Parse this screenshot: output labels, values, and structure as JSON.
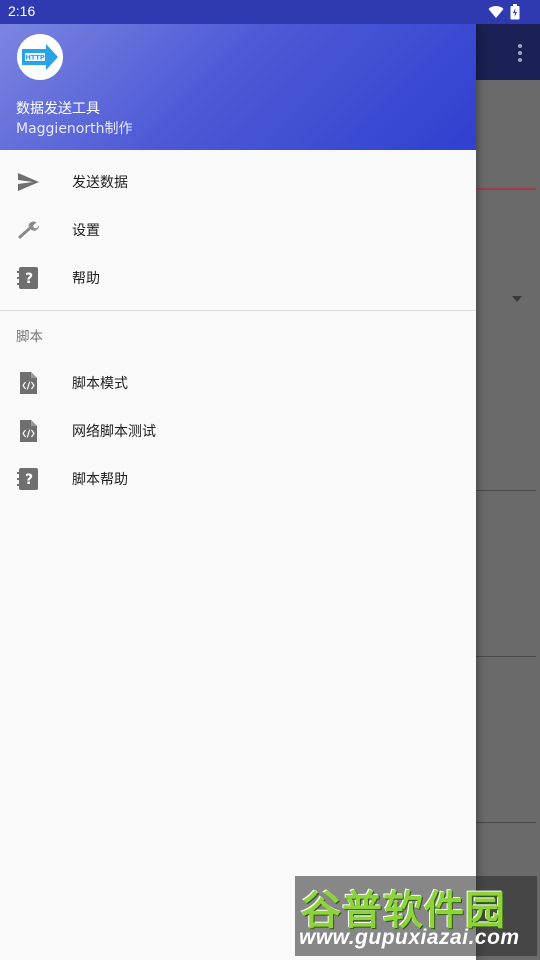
{
  "status_bar": {
    "time": "2:16",
    "icons": [
      "wifi-icon",
      "battery-icon"
    ]
  },
  "drawer": {
    "header": {
      "logo_icon": "http-arrow-logo",
      "title": "数据发送工具",
      "subtitle": "Maggienorth制作"
    },
    "items": [
      {
        "label": "发送数据",
        "icon": "send-icon"
      },
      {
        "label": "设置",
        "icon": "wrench-icon"
      },
      {
        "label": "帮助",
        "icon": "help-book-icon"
      }
    ],
    "section": {
      "title": "脚本",
      "items": [
        {
          "label": "脚本模式",
          "icon": "code-file-icon"
        },
        {
          "label": "网络脚本测试",
          "icon": "code-file-icon"
        },
        {
          "label": "脚本帮助",
          "icon": "help-book-icon"
        }
      ]
    }
  },
  "watermark": {
    "brand": "谷普软件园",
    "url": "www.gupuxiazai.com"
  },
  "colors": {
    "status_bar": "#2f3ab1",
    "header_gradient_start": "#7b85e0",
    "header_gradient_end": "#3040cf",
    "drawer_bg": "#fafafa",
    "scrim": "#6a6a6a"
  }
}
